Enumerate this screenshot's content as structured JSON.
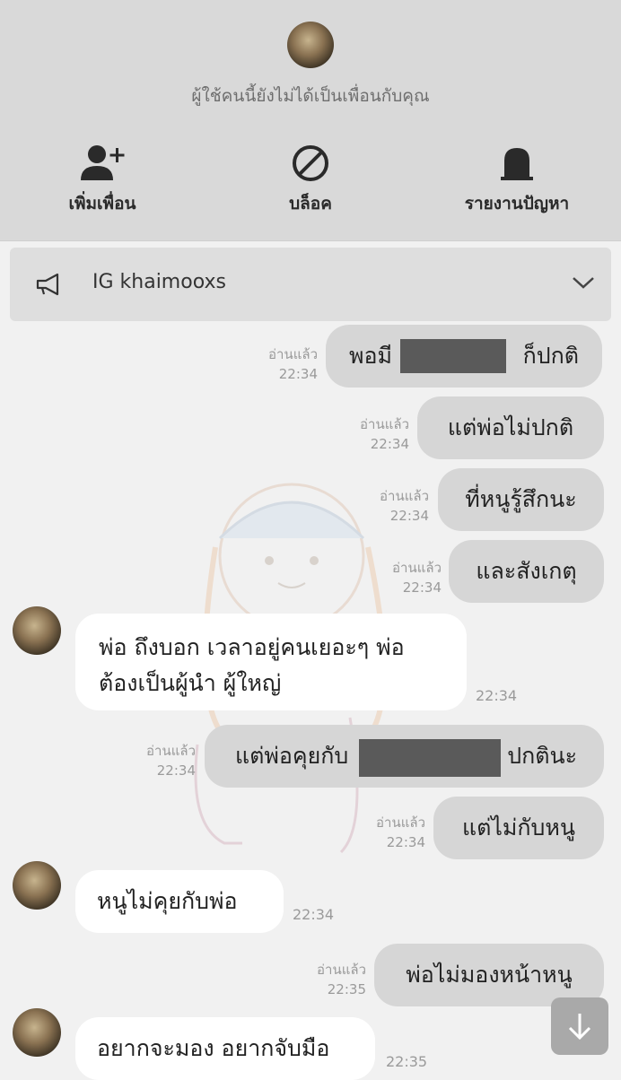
{
  "header": {
    "notice": "ผู้ใช้คนนี้ยังไม่ได้เป็นเพื่อนกับคุณ",
    "actions": [
      {
        "label": "เพิ่มเพื่อน",
        "icon": "add-friend-icon"
      },
      {
        "label": "บล็อค",
        "icon": "block-icon"
      },
      {
        "label": "รายงานปัญหา",
        "icon": "report-icon"
      }
    ]
  },
  "announcement": {
    "text": "IG khaimooxs",
    "icon": "megaphone-icon"
  },
  "messages": [
    {
      "side": "out",
      "text": "พอมี",
      "text_end": "ก็ปกติ",
      "redacted": true,
      "read": "อ่านแล้ว",
      "time": "22:34"
    },
    {
      "side": "out",
      "text": "แต่พ่อไม่ปกติ",
      "read": "อ่านแล้ว",
      "time": "22:34"
    },
    {
      "side": "out",
      "text": "ที่หนูรู้สึกนะ",
      "read": "อ่านแล้ว",
      "time": "22:34"
    },
    {
      "side": "out",
      "text": "และสังเกตุ",
      "read": "อ่านแล้ว",
      "time": "22:34"
    },
    {
      "side": "in",
      "line1": "พ่อ ถึงบอก  เวลาอยู่คนเยอะๆ พ่อ",
      "line2": "ต้องเป็นผู้นำ ผู้ใหญ่",
      "time": "22:34"
    },
    {
      "side": "out",
      "text": "แต่พ่อคุยกับ",
      "text_end": "ปกตินะ",
      "redacted": true,
      "read": "อ่านแล้ว",
      "time": "22:34"
    },
    {
      "side": "out",
      "text": "แต่ไม่กับหนู",
      "read": "อ่านแล้ว",
      "time": "22:34"
    },
    {
      "side": "in",
      "text": "หนูไม่คุยกับพ่อ",
      "time": "22:34"
    },
    {
      "side": "out",
      "text": "พ่อไม่มองหน้าหนู",
      "read": "อ่านแล้ว",
      "time": "22:35"
    },
    {
      "side": "in",
      "text": "อยากจะมอง อยากจับมือ",
      "time": "22:35"
    }
  ],
  "colors": {
    "outgoing_bubble": "#d6d6d6",
    "incoming_bubble": "#ffffff",
    "header_bg": "#d9d9d9"
  },
  "scroll_button": {
    "icon": "arrow-down-icon"
  }
}
